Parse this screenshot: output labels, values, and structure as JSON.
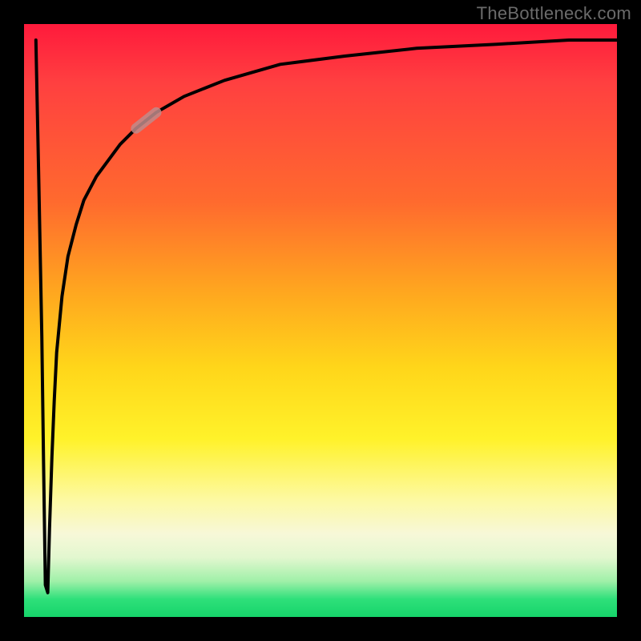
{
  "watermark": "TheBottleneck.com",
  "colors": {
    "frame": "#000000",
    "curve_stroke": "#000000",
    "highlight_stroke": "#c08b8b",
    "gradient_stops": [
      "#ff1a3c",
      "#ff6a2e",
      "#ffd61a",
      "#fdf9a0",
      "#16d46a"
    ]
  },
  "chart_data": {
    "type": "line",
    "title": "",
    "xlabel": "",
    "ylabel": "",
    "xlim": [
      0,
      100
    ],
    "ylim": [
      0,
      100
    ],
    "grid": false,
    "legend": false,
    "note": "Values estimated from pixel positions; axes unlabeled in source. y is plotted with 100 at top, 0 at bottom (matching a bottleneck % where low = good, colored green at bottom).",
    "series": [
      {
        "name": "bottleneck-curve",
        "x": [
          2.0,
          2.5,
          3.0,
          3.3,
          3.6,
          4.0,
          4.3,
          4.7,
          5.1,
          5.5,
          6.4,
          7.4,
          8.8,
          10.1,
          12.2,
          14.2,
          16.2,
          18.9,
          22.3,
          27.0,
          33.8,
          43.2,
          54.1,
          66.2,
          79.7,
          91.9,
          100.0
        ],
        "y": [
          97.3,
          73.0,
          47.3,
          25.7,
          5.4,
          4.1,
          14.9,
          27.0,
          36.5,
          44.6,
          54.1,
          60.8,
          66.2,
          70.3,
          74.3,
          77.0,
          79.7,
          82.4,
          85.1,
          87.8,
          90.5,
          93.2,
          94.6,
          95.9,
          96.6,
          97.3,
          97.3
        ]
      }
    ],
    "highlight_segment": {
      "series": "bottleneck-curve",
      "x_range": [
        18.9,
        25.0
      ],
      "comment": "Short thick pink-brown overlay segment on rising part of curve"
    }
  }
}
